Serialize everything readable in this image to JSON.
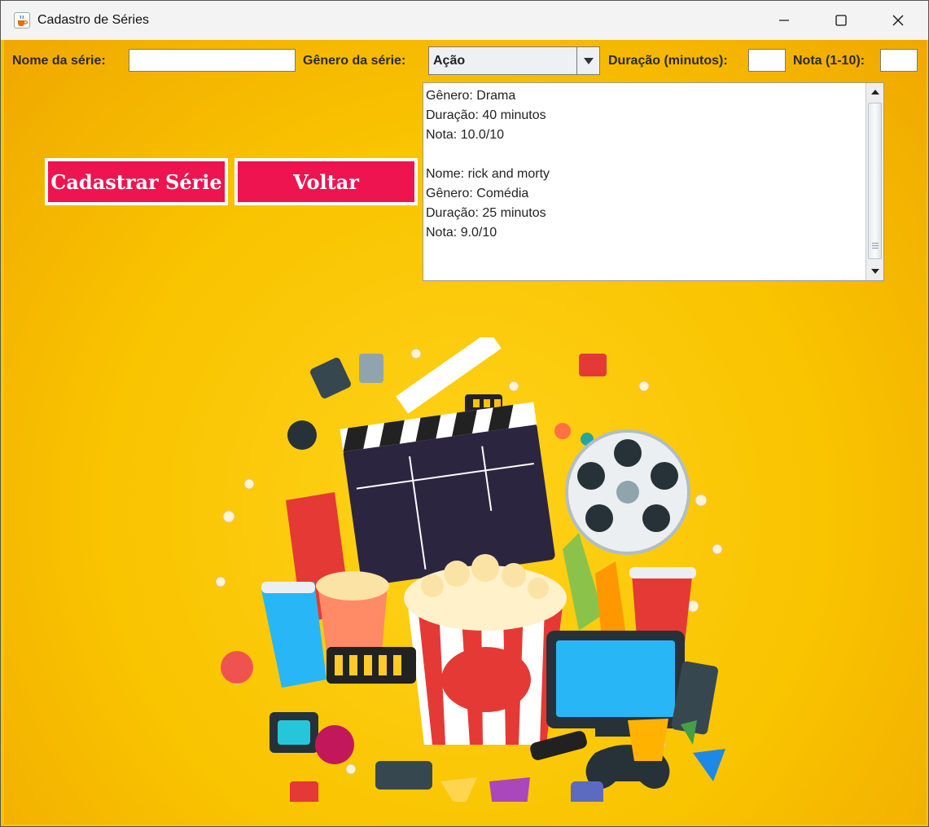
{
  "window": {
    "title": "Cadastro de Séries"
  },
  "form": {
    "nome_label": "Nome da série:",
    "nome_value": "",
    "genero_label": "Gênero da série:",
    "genero_selected": "Ação",
    "duracao_label": "Duração (minutos):",
    "duracao_value": "",
    "nota_label": "Nota (1-10):",
    "nota_value": ""
  },
  "buttons": {
    "cadastrar": "Cadastrar Série",
    "voltar": "Voltar"
  },
  "output": {
    "lines": [
      "Gênero: Drama",
      "Duração: 40 minutos",
      "Nota: 10.0/10",
      "",
      "Nome: rick and morty",
      "Gênero: Comédia",
      "Duração: 25 minutos",
      "Nota: 9.0/10"
    ]
  },
  "icons": {
    "app": "java-coffee-icon",
    "minimize": "minimize-icon",
    "maximize": "maximize-icon",
    "close": "close-icon",
    "dropdown": "chevron-down-icon"
  },
  "colors": {
    "background": "#f9c400",
    "button": "#ee1450",
    "button_border": "#ffffff"
  }
}
